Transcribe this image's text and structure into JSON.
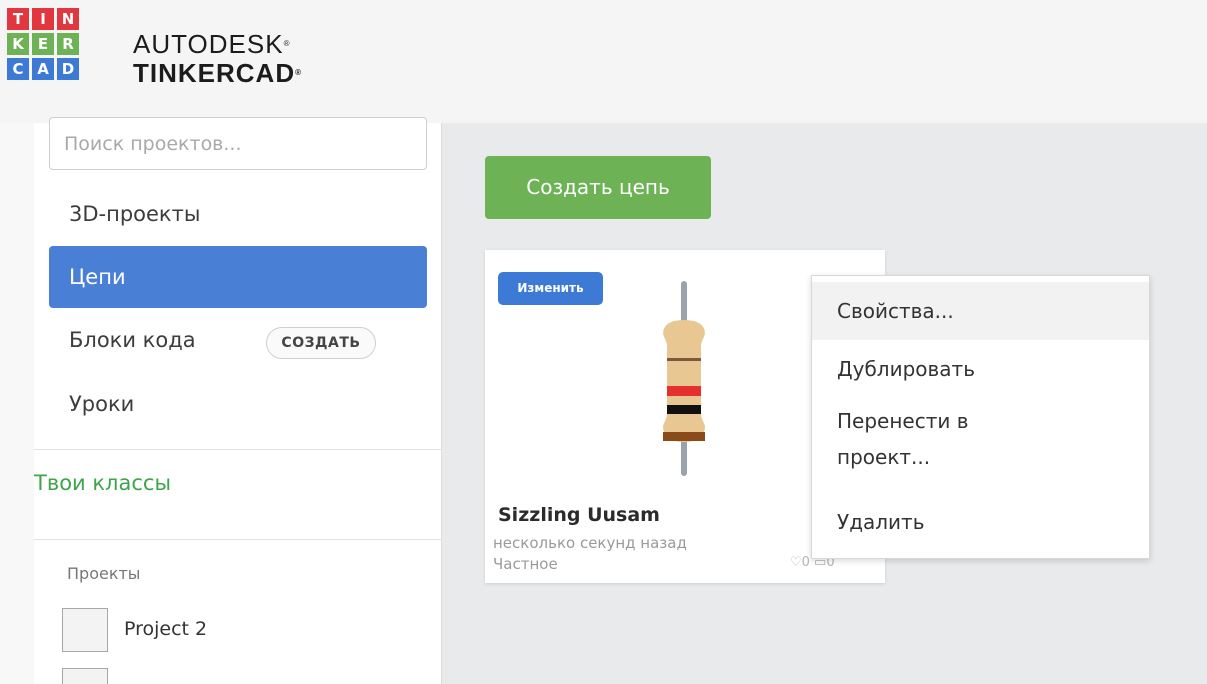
{
  "header": {
    "logo_letters": [
      "T",
      "I",
      "N",
      "K",
      "E",
      "R",
      "C",
      "A",
      "D"
    ],
    "logo_colors": [
      "#e2373f",
      "#e2373f",
      "#e2373f",
      "#6db356",
      "#6db356",
      "#6db356",
      "#3d7ad6",
      "#3d7ad6",
      "#3d7ad6"
    ],
    "brand_line1": "AUTODESK",
    "brand_line2": "TINKERCAD"
  },
  "sidebar": {
    "search_placeholder": "Поиск проектов...",
    "nav": [
      {
        "label": "3D-проекты"
      },
      {
        "label": "Цепи",
        "active": true
      },
      {
        "label": "Блоки кода",
        "badge": "СОЗДАТЬ"
      },
      {
        "label": "Уроки"
      }
    ],
    "classes_label": "Твои классы",
    "projects_heading": "Проекты",
    "projects": [
      {
        "name": "Project 2"
      }
    ]
  },
  "main": {
    "create_button": "Создать цепь",
    "card": {
      "edit_badge": "Изменить",
      "title": "Sizzling Uusam",
      "time": "несколько секунд назад",
      "privacy": "Частное",
      "stats": "♡0 ▭0"
    },
    "context_menu": [
      {
        "label": "Свойства..."
      },
      {
        "label": "Дублировать"
      },
      {
        "label": "Перенести в проект..."
      },
      {
        "label": "Удалить"
      }
    ]
  },
  "colors": {
    "accent_blue": "#4a7fd6",
    "create_green": "#6db356",
    "classes_green": "#3fa54b"
  }
}
